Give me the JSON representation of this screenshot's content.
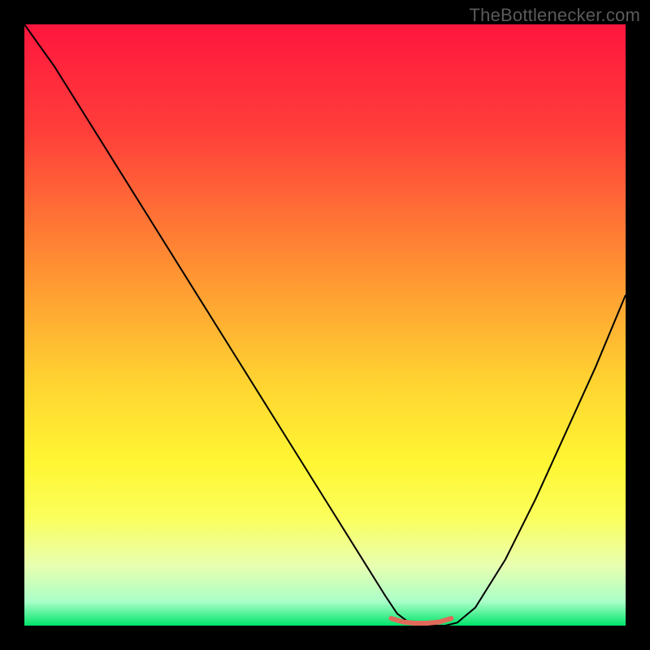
{
  "watermark": "TheBottlenecker.com",
  "chart_data": {
    "type": "line",
    "title": "",
    "xlabel": "",
    "ylabel": "",
    "xlim": [
      0,
      100
    ],
    "ylim": [
      0,
      100
    ],
    "gradient_stops": [
      {
        "offset": 0,
        "color": "#ff163e"
      },
      {
        "offset": 18,
        "color": "#ff3f3a"
      },
      {
        "offset": 40,
        "color": "#ff8f33"
      },
      {
        "offset": 60,
        "color": "#ffd531"
      },
      {
        "offset": 73,
        "color": "#fff633"
      },
      {
        "offset": 82,
        "color": "#fbff5c"
      },
      {
        "offset": 90,
        "color": "#e8ffb0"
      },
      {
        "offset": 96,
        "color": "#aaffc8"
      },
      {
        "offset": 100,
        "color": "#00e46a"
      }
    ],
    "series": [
      {
        "name": "curve",
        "color": "#000000",
        "width": 2,
        "x": [
          0,
          5,
          10,
          15,
          20,
          25,
          30,
          35,
          40,
          45,
          50,
          55,
          60,
          62,
          64,
          67,
          70,
          72,
          75,
          80,
          85,
          90,
          95,
          100
        ],
        "y": [
          100,
          93,
          85,
          77,
          69,
          61,
          53,
          45,
          37,
          29,
          21,
          13,
          5,
          2,
          0.5,
          0,
          0,
          0.5,
          3,
          11,
          21,
          32,
          43,
          55
        ]
      },
      {
        "name": "bottom-marker",
        "color": "#e06a5a",
        "width": 6,
        "x": [
          61,
          63,
          65,
          67,
          69,
          71
        ],
        "y": [
          1.2,
          0.6,
          0.4,
          0.4,
          0.6,
          1.2
        ]
      }
    ]
  }
}
